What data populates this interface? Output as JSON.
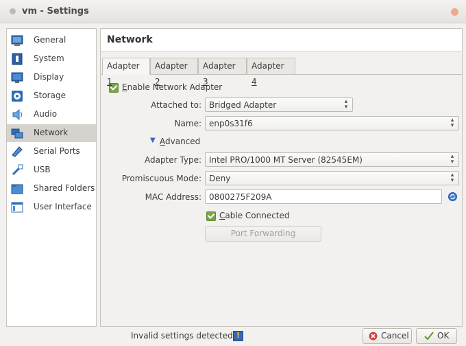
{
  "window": {
    "title": "vm - Settings"
  },
  "sidebar": {
    "items": [
      {
        "label": "General",
        "icon": "general-icon"
      },
      {
        "label": "System",
        "icon": "system-icon"
      },
      {
        "label": "Display",
        "icon": "display-icon"
      },
      {
        "label": "Storage",
        "icon": "storage-icon"
      },
      {
        "label": "Audio",
        "icon": "audio-icon"
      },
      {
        "label": "Network",
        "icon": "network-icon",
        "selected": true
      },
      {
        "label": "Serial Ports",
        "icon": "serial-ports-icon"
      },
      {
        "label": "USB",
        "icon": "usb-icon"
      },
      {
        "label": "Shared Folders",
        "icon": "shared-folders-icon"
      },
      {
        "label": "User Interface",
        "icon": "user-interface-icon"
      }
    ]
  },
  "main": {
    "title": "Network",
    "tabs": [
      {
        "label": "Adapter",
        "num": "1",
        "active": true
      },
      {
        "label": "Adapter",
        "num": "2"
      },
      {
        "label": "Adapter",
        "num": "3"
      },
      {
        "label": "Adapter",
        "num": "4"
      }
    ],
    "enable_adapter": {
      "label_first": "E",
      "label_rest": "nable Network Adapter",
      "checked": true
    },
    "attached_to": {
      "label": "Attached to:",
      "value": "Bridged Adapter"
    },
    "name": {
      "label": "Name:",
      "value": "enp0s31f6"
    },
    "advanced": {
      "label_first": "A",
      "label_rest": "dvanced",
      "expanded": true
    },
    "adapter_type": {
      "label": "Adapter Type:",
      "value": "Intel PRO/1000 MT Server (82545EM)"
    },
    "promiscuous": {
      "label": "Promiscuous Mode:",
      "value": "Deny"
    },
    "mac": {
      "label": "MAC Address:",
      "value": "0800275F209A"
    },
    "cable": {
      "label_first": "C",
      "label_rest": "able Connected",
      "checked": true
    },
    "port_forwarding": {
      "label": "Port Forwarding"
    }
  },
  "footer": {
    "status": "Invalid settings detected",
    "cancel": "Cancel",
    "ok": "OK"
  },
  "colors": {
    "accent_check": "#7aa54a",
    "selection": "#d6d3ce",
    "close": "#f0aa8d"
  }
}
